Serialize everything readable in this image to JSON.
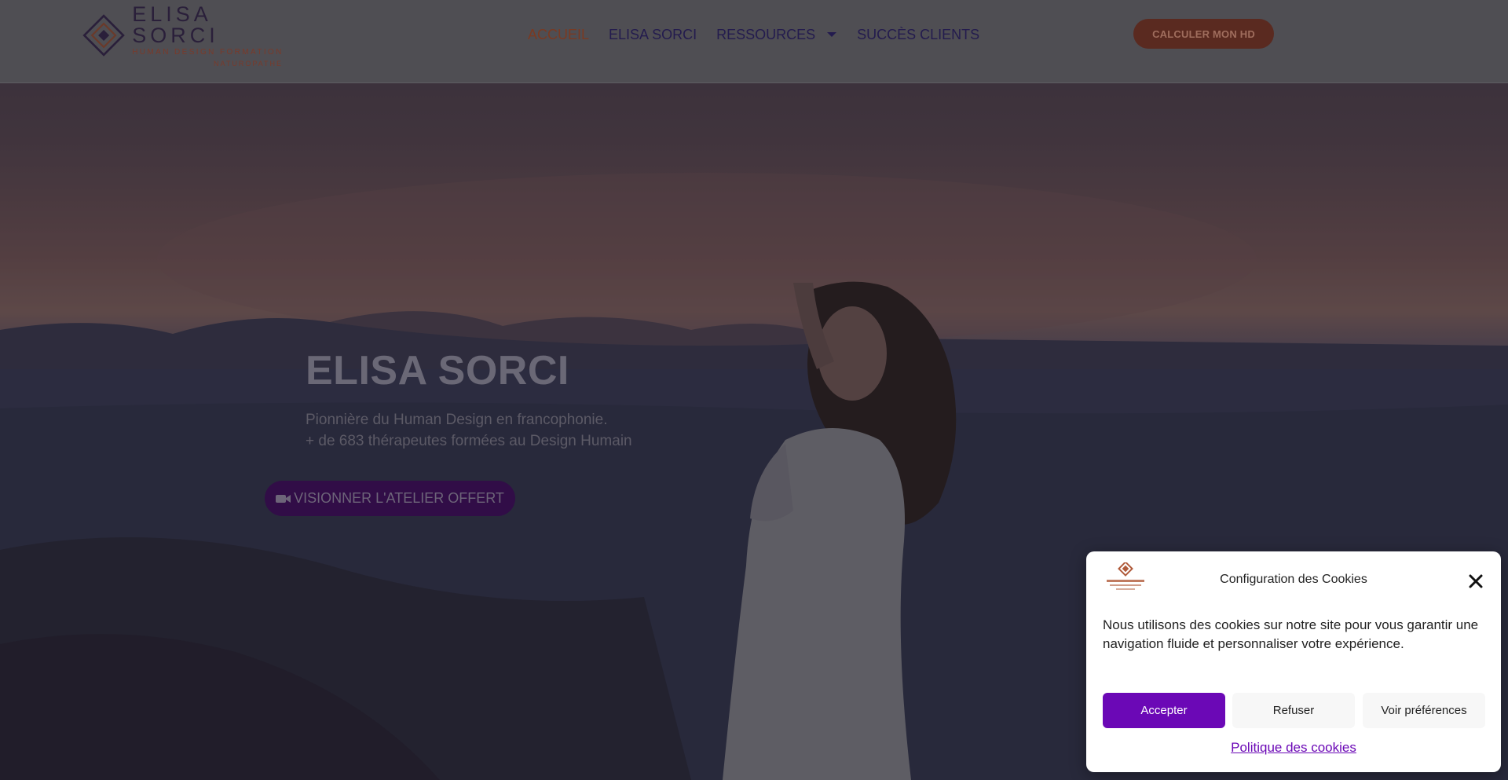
{
  "header": {
    "logo": {
      "name": "ELISA SORCI",
      "subtitle": "HUMAN DESIGN FORMATION",
      "subtitle2": "NATUROPATHE"
    },
    "nav": [
      {
        "label": "ACCUEIL",
        "active": true
      },
      {
        "label": "ELISA SORCI",
        "active": false
      },
      {
        "label": "RESSOURCES",
        "active": false,
        "has_dropdown": true
      },
      {
        "label": "SUCCÈS CLIENTS",
        "active": false
      }
    ],
    "cta_label": "CALCULER MON HD"
  },
  "hero": {
    "title": "ELISA SORCI",
    "subtitle_lines": [
      "Pionnière du Human Design en francophonie.",
      "+ de 683 thérapeutes formées au Design Humain"
    ],
    "cta_label": "VISIONNER L'ATELIER OFFERT",
    "cta_icon": "video-camera-icon"
  },
  "cookie_banner": {
    "title": "Configuration des Cookies",
    "text": "Nous utilisons des cookies sur notre site pour vous garantir une navigation fluide et personnaliser votre expérience.",
    "buttons": {
      "accept": "Accepter",
      "refuse": "Refuser",
      "preferences": "Voir préférences"
    },
    "policy_link": "Politique des cookies",
    "close_icon": "close-icon"
  },
  "colors": {
    "accent_purple": "#6b08b6",
    "nav_active": "#7a3a22",
    "nav_text": "#231b4e",
    "header_cta": "#5a2a20"
  }
}
